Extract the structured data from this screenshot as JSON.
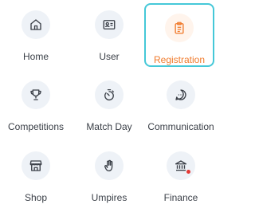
{
  "colors": {
    "accent": "#f07a2b",
    "focus_ring": "#45c8d8",
    "icon_bg": "#eef2f7",
    "notification_dot": "#e53935"
  },
  "tiles": [
    {
      "label": "Home",
      "icon": "home-icon"
    },
    {
      "label": "User",
      "icon": "id-card-icon"
    },
    {
      "label": "Registration",
      "icon": "clipboard-icon",
      "active": true
    },
    {
      "label": "Competitions",
      "icon": "trophy-icon"
    },
    {
      "label": "Match Day",
      "icon": "stopwatch-icon"
    },
    {
      "label": "Communication",
      "icon": "chat-icon"
    },
    {
      "label": "Shop",
      "icon": "store-icon"
    },
    {
      "label": "Umpires",
      "icon": "hand-icon"
    },
    {
      "label": "Finance",
      "icon": "bank-icon",
      "notification": true
    }
  ]
}
